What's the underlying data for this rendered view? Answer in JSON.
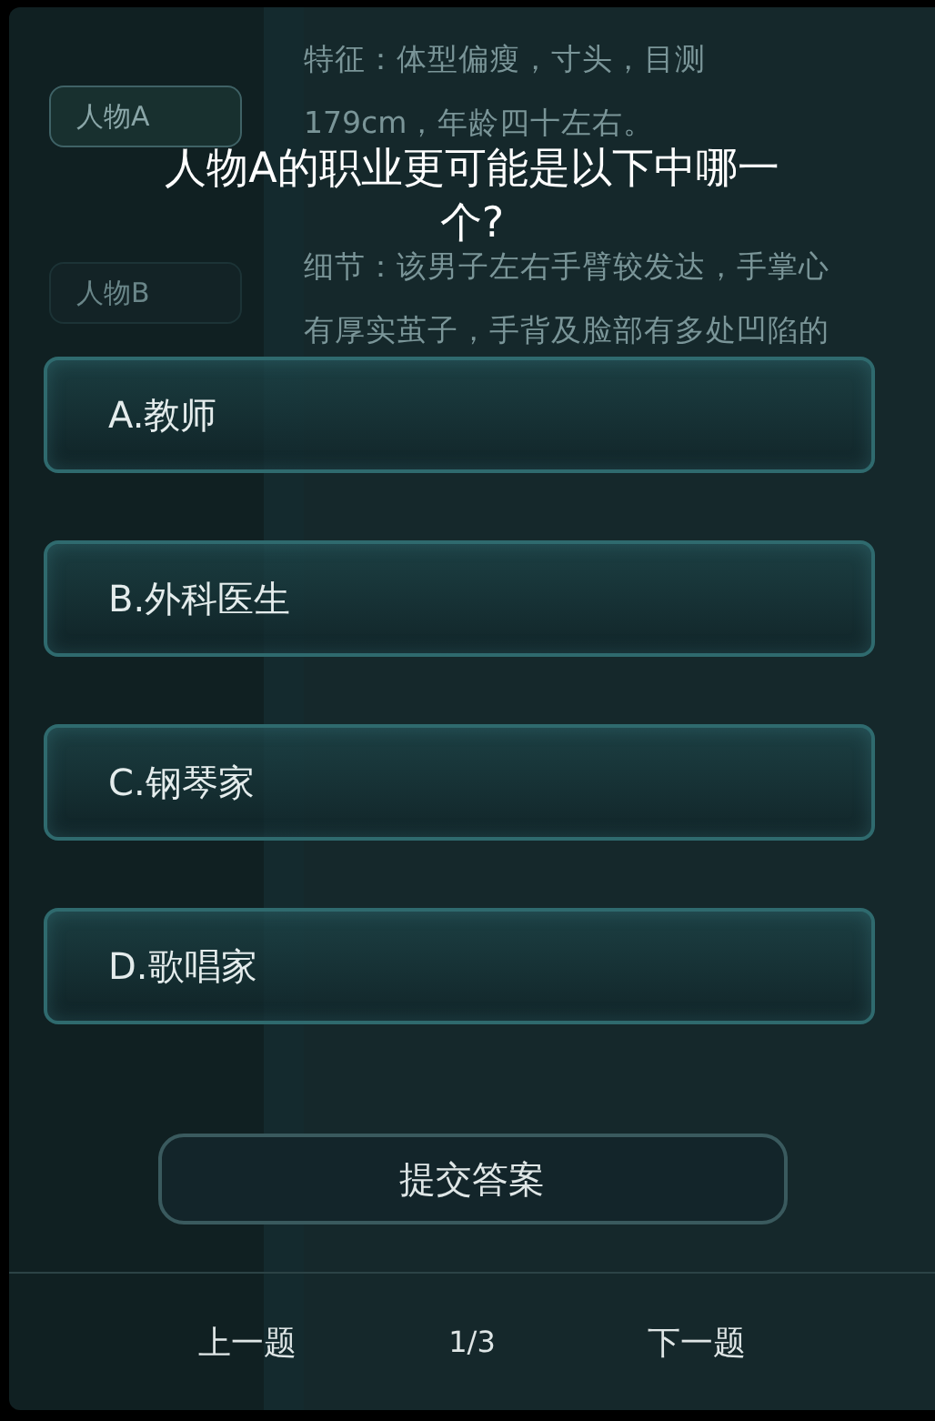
{
  "background": {
    "tabs": [
      {
        "label": "人物A",
        "selected": true
      },
      {
        "label": "人物B",
        "selected": false
      }
    ],
    "lines": [
      "特征：体型偏瘦，寸头，目测",
      "179cm，年龄四十左右。",
      "细节：该男子左右手臂较发达，手掌心",
      "有厚实茧子，手背及脸部有多处凹陷的"
    ]
  },
  "question": "人物A的职业更可能是以下中哪一个?",
  "options": [
    {
      "label": "A.教师",
      "selected": false
    },
    {
      "label": "B.外科医生",
      "selected": false
    },
    {
      "label": "C.钢琴家",
      "selected": false
    },
    {
      "label": "D.歌唱家",
      "selected": false
    }
  ],
  "submit": "提交答案",
  "nav": {
    "prev": "上一题",
    "page": "1/3",
    "next": "下一题"
  }
}
